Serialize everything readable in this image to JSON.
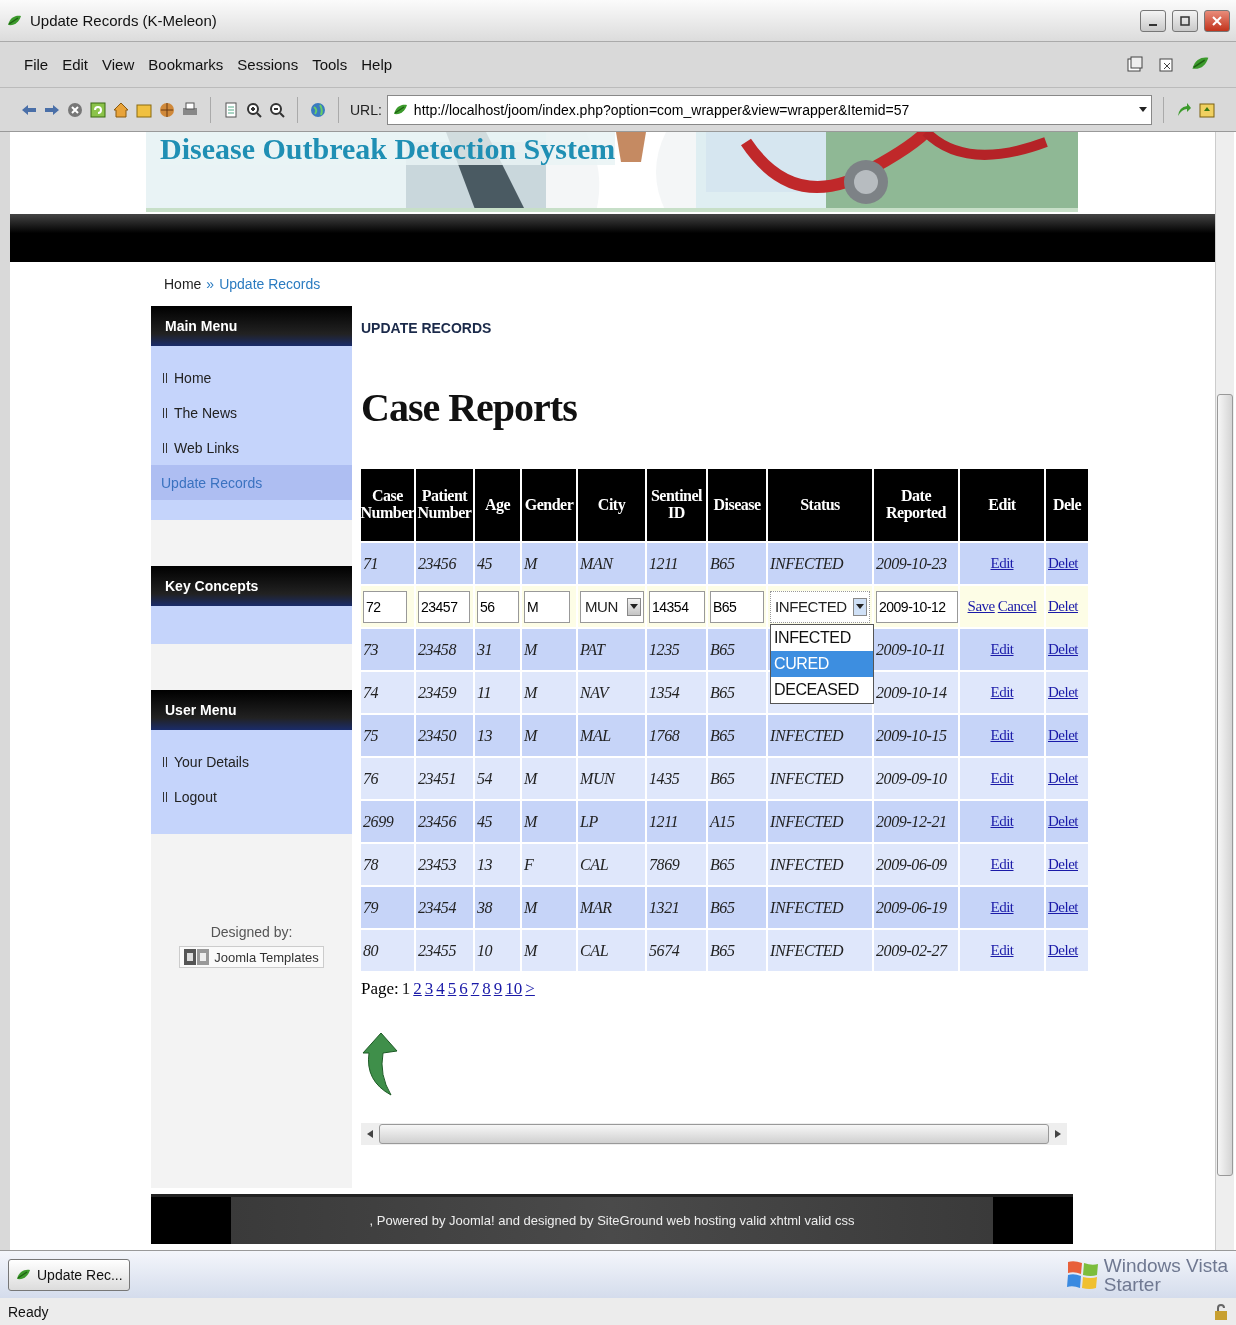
{
  "window": {
    "title": "Update Records (K-Meleon)"
  },
  "menu": [
    "File",
    "Edit",
    "View",
    "Bookmarks",
    "Sessions",
    "Tools",
    "Help"
  ],
  "address": {
    "label": "URL:",
    "value": "http://localhost/joom/index.php?option=com_wrapper&view=wrapper&Itemid=57"
  },
  "site": {
    "title": "Disease Outbreak Detection System",
    "breadcrumb": [
      {
        "label": "Home",
        "selected": false
      },
      {
        "label": "Update Records",
        "selected": true
      }
    ],
    "breadcrumb_separator": "»"
  },
  "sidebar": {
    "modules": [
      {
        "title": "Main Menu",
        "items": [
          {
            "label": "Home",
            "selected": false
          },
          {
            "label": "The News",
            "selected": false
          },
          {
            "label": "Web Links",
            "selected": false
          },
          {
            "label": "Update Records",
            "selected": true
          }
        ]
      },
      {
        "title": "Key Concepts"
      },
      {
        "title": "User Menu",
        "items": [
          {
            "label": "Your Details",
            "selected": false
          },
          {
            "label": "Logout",
            "selected": false
          }
        ]
      }
    ],
    "designed_by": {
      "label": "Designed by:",
      "badge": "Joomla Templates"
    }
  },
  "content": {
    "section": "UPDATE RECORDS",
    "heading": "Case Reports",
    "table": {
      "columns": [
        "Case Number",
        "Patient Number",
        "Age",
        "Gender",
        "City",
        "Sentinel ID",
        "Disease",
        "Status",
        "Date Reported",
        "Edit",
        "Dele"
      ],
      "rows": [
        {
          "kind": "view",
          "case": "71",
          "patient": "23456",
          "age": "45",
          "gender": "M",
          "city": "MAN",
          "sentinel": "1211",
          "disease": "B65",
          "status": "INFECTED",
          "date": "2009-10-23",
          "edit": "Edit",
          "delete": "Delet"
        },
        {
          "kind": "edit",
          "case": "72",
          "patient": "23457",
          "age": "56",
          "gender": "M",
          "city": "MUN",
          "sentinel": "14354",
          "disease": "B65",
          "status": "INFECTED",
          "expanded": true,
          "status_options": [
            {
              "label": "INFECTED",
              "selected": false
            },
            {
              "label": "CURED",
              "selected": true
            },
            {
              "label": "DECEASED",
              "selected": false
            }
          ],
          "date": "2009-10-12",
          "save": "Save",
          "cancel": "Cancel",
          "delete": "Delet"
        },
        {
          "kind": "view",
          "case": "73",
          "patient": "23458",
          "age": "31",
          "gender": "M",
          "city": "PAT",
          "sentinel": "1235",
          "disease": "B65",
          "date": "2009-10-11",
          "edit": "Edit",
          "delete": "Delet"
        },
        {
          "kind": "view",
          "case": "74",
          "patient": "23459",
          "age": "11",
          "gender": "M",
          "city": "NAV",
          "sentinel": "1354",
          "disease": "B65",
          "date": "2009-10-14",
          "edit": "Edit",
          "delete": "Delet"
        },
        {
          "kind": "view",
          "case": "75",
          "patient": "23450",
          "age": "13",
          "gender": "M",
          "city": "MAL",
          "sentinel": "1768",
          "disease": "B65",
          "status": "INFECTED",
          "date": "2009-10-15",
          "edit": "Edit",
          "delete": "Delet"
        },
        {
          "kind": "view",
          "case": "76",
          "patient": "23451",
          "age": "54",
          "gender": "M",
          "city": "MUN",
          "sentinel": "1435",
          "disease": "B65",
          "status": "INFECTED",
          "date": "2009-09-10",
          "edit": "Edit",
          "delete": "Delet"
        },
        {
          "kind": "view",
          "case": "2699",
          "patient": "23456",
          "age": "45",
          "gender": "M",
          "city": "LP",
          "sentinel": "1211",
          "disease": "A15",
          "status": "INFECTED",
          "date": "2009-12-21",
          "edit": "Edit",
          "delete": "Delet"
        },
        {
          "kind": "view",
          "case": "78",
          "patient": "23453",
          "age": "13",
          "gender": "F",
          "city": "CAL",
          "sentinel": "7869",
          "disease": "B65",
          "status": "INFECTED",
          "date": "2009-06-09",
          "edit": "Edit",
          "delete": "Delet"
        },
        {
          "kind": "view",
          "case": "79",
          "patient": "23454",
          "age": "38",
          "gender": "M",
          "city": "MAR",
          "sentinel": "1321",
          "disease": "B65",
          "status": "INFECTED",
          "date": "2009-06-19",
          "edit": "Edit",
          "delete": "Delet"
        },
        {
          "kind": "view",
          "case": "80",
          "patient": "23455",
          "age": "10",
          "gender": "M",
          "city": "CAL",
          "sentinel": "5674",
          "disease": "B65",
          "status": "INFECTED",
          "date": "2009-02-27",
          "edit": "Edit",
          "delete": "Delet"
        }
      ]
    },
    "pagination": {
      "label": "Page:",
      "pages": [
        {
          "label": "1",
          "selected": true
        },
        {
          "label": "2",
          "selected": false
        },
        {
          "label": "3",
          "selected": false
        },
        {
          "label": "4",
          "selected": false
        },
        {
          "label": "5",
          "selected": false
        },
        {
          "label": "6",
          "selected": false
        },
        {
          "label": "7",
          "selected": false
        },
        {
          "label": "8",
          "selected": false
        },
        {
          "label": "9",
          "selected": false
        },
        {
          "label": "10",
          "selected": false
        }
      ],
      "next": ">"
    }
  },
  "footer": {
    "text": ", Powered by Joomla! and designed by SiteGround web hosting valid xhtml valid css"
  },
  "taskbar": {
    "button": "Update Rec..."
  },
  "os_badge": {
    "line1": "Windows Vista",
    "line2": "Starter"
  },
  "status_bar": {
    "text": "Ready"
  }
}
